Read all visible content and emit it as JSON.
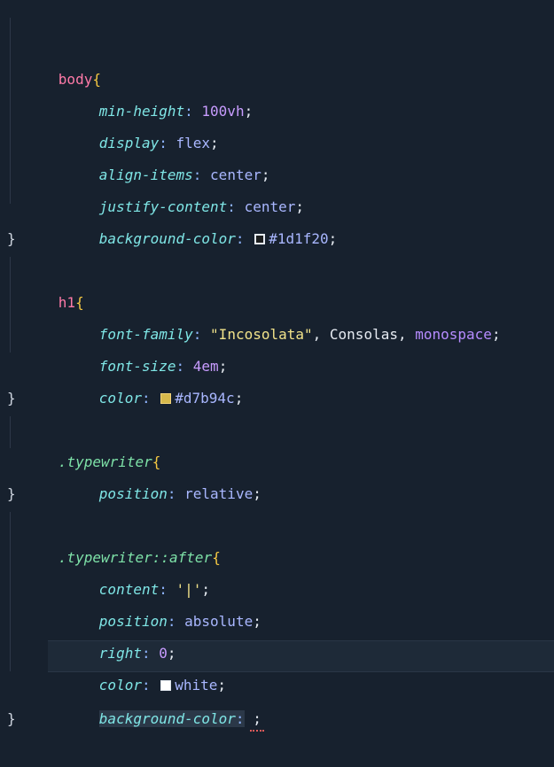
{
  "lines": [
    {
      "selector": "body",
      "open": "{"
    },
    {
      "prop": "min-height",
      "value": "100vh"
    },
    {
      "prop": "display",
      "value": "flex"
    },
    {
      "prop": "align-items",
      "value": "center"
    },
    {
      "prop": "justify-content",
      "value": "center"
    },
    {
      "prop": "background-color",
      "value": "#1d1f20",
      "swatch": "#1d1f20"
    },
    {
      "close": "}"
    },
    {
      "selector": "h1",
      "open": "{"
    },
    {
      "prop": "font-family",
      "value_parts": [
        "\"Incosolata\"",
        ", ",
        "Consolas",
        ", ",
        "monospace"
      ]
    },
    {
      "prop": "font-size",
      "value": "4em"
    },
    {
      "prop": "color",
      "value": "#d7b94c",
      "swatch": "#d7b94c"
    },
    {
      "close": "}"
    },
    {
      "selector": ".typewriter",
      "open": "{"
    },
    {
      "prop": "position",
      "value": "relative"
    },
    {
      "close": "}"
    },
    {
      "selector": ".typewriter::after",
      "open": "{"
    },
    {
      "prop": "content",
      "value": "'|'"
    },
    {
      "prop": "position",
      "value": "absolute"
    },
    {
      "prop": "right",
      "value": "0"
    },
    {
      "prop": "color",
      "value": "white",
      "swatch": "#ffffff"
    },
    {
      "prop": "background-color",
      "value": ""
    },
    {
      "close": "}"
    }
  ],
  "punct": {
    "colon": ":",
    "semi": ";"
  }
}
